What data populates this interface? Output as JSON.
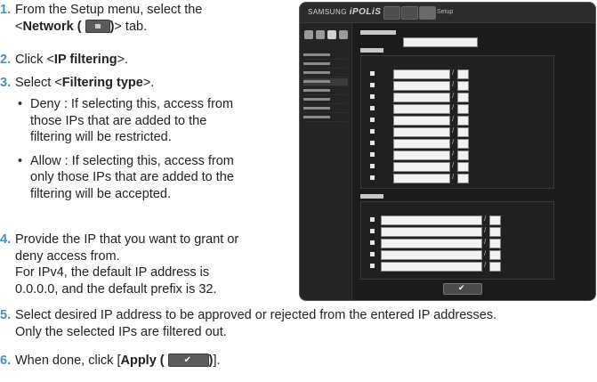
{
  "steps": {
    "s1": {
      "num": "1.",
      "line1": "From the Setup menu, select the",
      "line2_pre": "<",
      "line2_bold": "Network (",
      "line2_bold2": ")",
      "line2_post": "> tab.",
      "icon": "network-icon"
    },
    "s2": {
      "num": "2.",
      "pre": "Click <",
      "bold": "IP filtering",
      "post": ">."
    },
    "s3": {
      "num": "3.",
      "pre": "Select <",
      "bold": "Filtering type",
      "post": ">."
    },
    "bullets": [
      {
        "l1": "Deny : If selecting this, access from",
        "l2": "those IPs that are added to the",
        "l3": "filtering will be restricted."
      },
      {
        "l1": "Allow : If selecting this, access from",
        "l2": "only those IPs that are added to the",
        "l3": "filtering will be accepted."
      }
    ],
    "s4": {
      "num": "4.",
      "l1": "Provide the IP that you want to grant or",
      "l2": "deny access from.",
      "l3": "For IPv4, the default IP address is",
      "l4": "0.0.0.0, and the default prefix is 32."
    },
    "s5": {
      "num": "5.",
      "l1": "Select desired IP address to be approved or rejected from the entered IP addresses.",
      "l2": "Only the selected IPs are filtered out."
    },
    "s6": {
      "num": "6.",
      "pre": "When done, click [",
      "bold": "Apply (",
      "bold2": ")",
      "post": "].",
      "icon": "checkmark-icon"
    }
  },
  "screenshot": {
    "brand_prefix": "SAMSUNG",
    "brand_name": "iPOLiS",
    "tab_label": "Setup",
    "colors": {
      "accent": "#4a8fc4",
      "background": "#1e1e1e"
    }
  }
}
